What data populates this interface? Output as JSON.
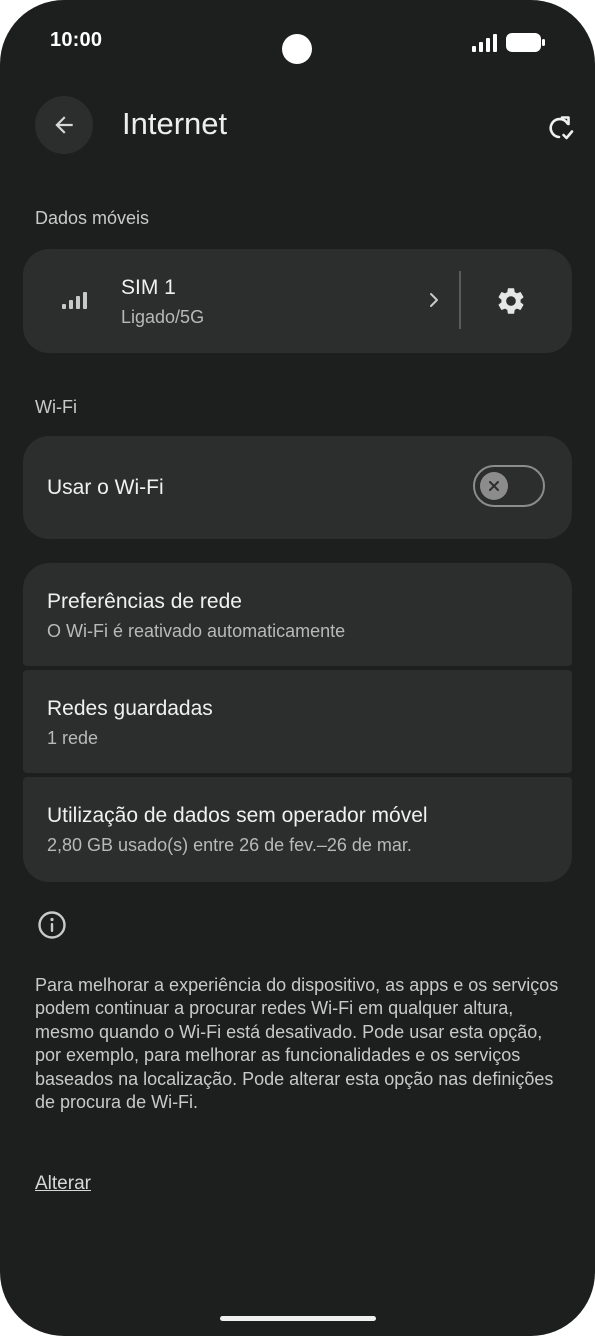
{
  "status_bar": {
    "time": "10:00"
  },
  "header": {
    "title": "Internet"
  },
  "mobile_data": {
    "section_label": "Dados móveis",
    "sim_name": "SIM 1",
    "sim_status": "Ligado/5G"
  },
  "wifi": {
    "section_label": "Wi-Fi",
    "toggle_label": "Usar o Wi-Fi",
    "toggle_on": false
  },
  "settings_rows": [
    {
      "title": "Preferências de rede",
      "subtitle": "O Wi-Fi é reativado automaticamente"
    },
    {
      "title": "Redes guardadas",
      "subtitle": "1 rede"
    },
    {
      "title": "Utilização de dados sem operador móvel",
      "subtitle": "2,80 GB usado(s) entre 26 de fev.–26 de mar."
    }
  ],
  "info": {
    "text": "Para melhorar a experiência do dispositivo, as apps e os serviços podem continuar a procurar redes Wi-Fi em qualquer altura, mesmo quando o Wi-Fi está desativado. Pode usar esta opção, por exemplo, para melhorar as funcionalidades e os serviços baseados na localização. Pode alterar esta opção nas definições de procura de Wi-Fi.",
    "link": "Alterar"
  },
  "colors": {
    "background": "#1d1e1e",
    "card": "#2c2d2d",
    "text_primary": "#f0f0f0",
    "text_secondary": "#b9b9b9"
  }
}
